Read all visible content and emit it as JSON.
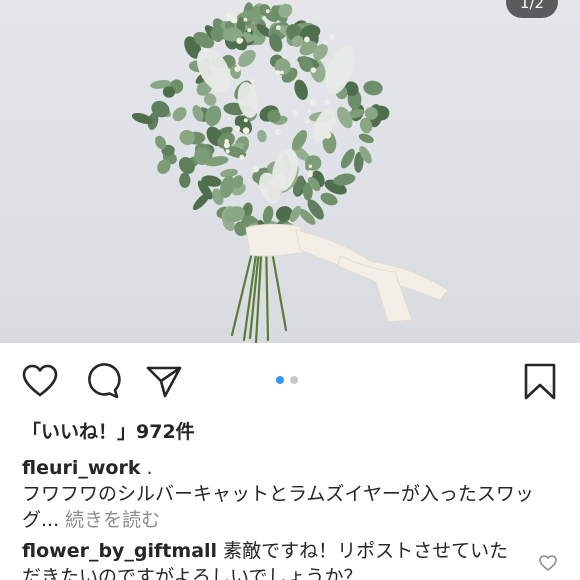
{
  "post": {
    "image_counter": "1/2",
    "carousel_dots": 2,
    "carousel_active": 0
  },
  "actions": {
    "like_icon": "heart-outline-icon",
    "comment_icon": "speech-bubble-icon",
    "share_icon": "paper-plane-icon",
    "save_icon": "bookmark-icon"
  },
  "likes": {
    "text": "「いいね！」972件"
  },
  "caption": {
    "username": "fleuri_work",
    "separator": " .",
    "text": "フワフワのシルバーキャットとラムズイヤーが入ったスワッグ... ",
    "more_label": "続きを読む"
  },
  "comment": {
    "username": "flower_by_giftmall",
    "text": " 素敵ですね！リポストさせていただきたいのですがよろしいでしょうか？"
  },
  "colors": {
    "accent_blue": "#3897f0",
    "text": "#262626",
    "muted": "#8e8e8e"
  }
}
